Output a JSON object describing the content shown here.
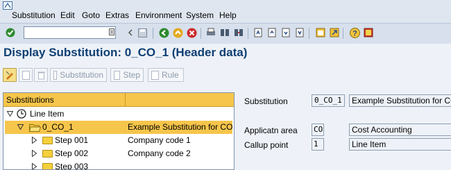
{
  "menu": [
    "Substitution",
    "Edit",
    "Goto",
    "Extras",
    "Environment",
    "System",
    "Help"
  ],
  "toolbar": {
    "command_field": ""
  },
  "title": "Display Substitution: 0_CO_1 (Header data)",
  "app_toolbar": {
    "substitution": "Substitution",
    "step": "Step",
    "rule": "Rule"
  },
  "tree": {
    "headers": [
      "Substitutions",
      ""
    ],
    "rows": [
      {
        "text": "Line Item",
        "desc": ""
      },
      {
        "text": "0_CO_1",
        "desc": "Example Substitution for CO"
      },
      {
        "text": "Step 001",
        "desc": "Company code 1"
      },
      {
        "text": "Step 002",
        "desc": "Company code 2"
      },
      {
        "text": "Step 003",
        "desc": ""
      }
    ]
  },
  "form": {
    "substitution_label": "Substitution",
    "substitution_value": "0_CO_1",
    "substitution_desc": "Example Substitution for CO",
    "applicatn_label": "Applicatn area",
    "applicatn_value": "CO",
    "applicatn_desc": "Cost Accounting",
    "callup_label": "Callup point",
    "callup_value": "1",
    "callup_desc": "Line Item"
  },
  "colors": {
    "selection": "#f6c54b",
    "title": "#0f3f73"
  }
}
